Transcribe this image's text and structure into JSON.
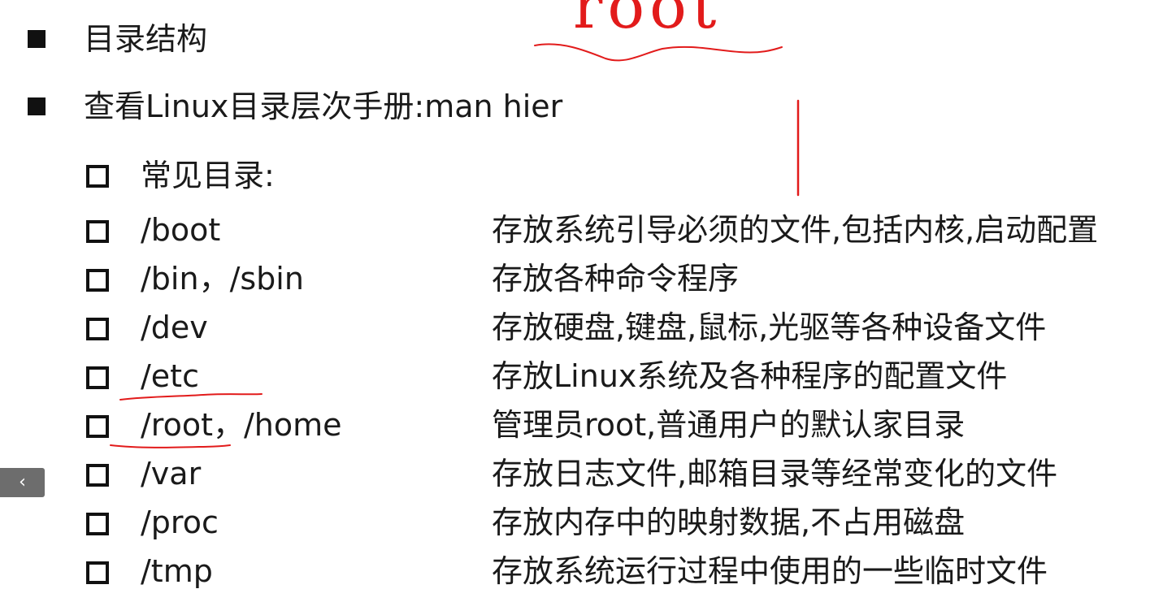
{
  "slide": {
    "bullets": [
      {
        "text": "目录结构"
      },
      {
        "text": "查看Linux目录层次手册:man hier"
      }
    ],
    "common_heading": "常见目录:",
    "directories": [
      {
        "path": "/boot",
        "desc": "存放系统引导必须的文件,包括内核,启动配置"
      },
      {
        "path": "/bin，/sbin",
        "desc": "存放各种命令程序"
      },
      {
        "path": "/dev",
        "desc": "存放硬盘,键盘,鼠标,光驱等各种设备文件"
      },
      {
        "path": "/etc",
        "desc": "存放Linux系统及各种程序的配置文件"
      },
      {
        "path": "/root，/home",
        "desc": "管理员root,普通用户的默认家目录"
      },
      {
        "path": "/var",
        "desc": "存放日志文件,邮箱目录等经常变化的文件"
      },
      {
        "path": "/proc",
        "desc": "存放内存中的映射数据,不占用磁盘"
      },
      {
        "path": "/tmp",
        "desc": "存放系统运行过程中使用的一些临时文件"
      }
    ]
  },
  "annotations": {
    "handwritten_word": "root",
    "ink_color": "#e21b1b"
  },
  "nav": {
    "prev_icon": "chevron-left-icon",
    "prev_glyph": "‹"
  }
}
